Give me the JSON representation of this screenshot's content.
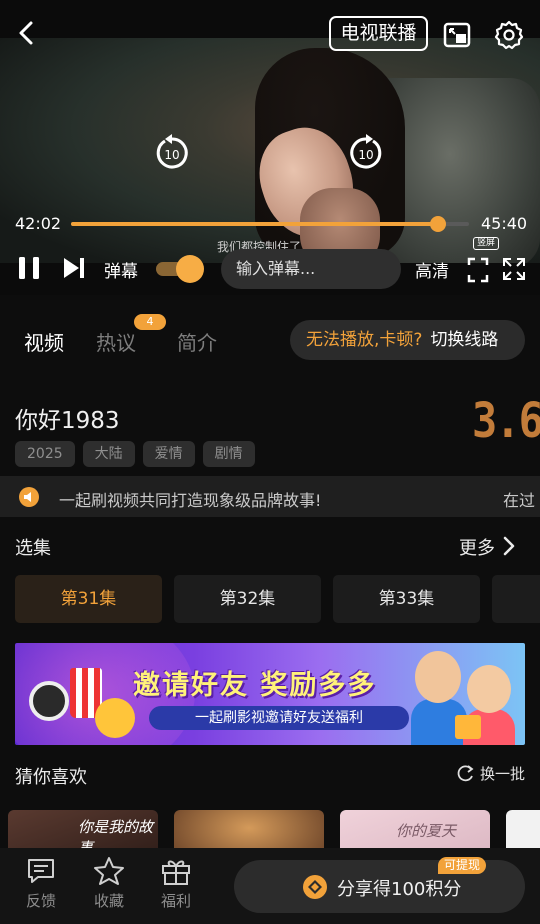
{
  "player": {
    "tv_button": "电视联播",
    "current_time": "42:02",
    "duration": "45:40",
    "progress_fraction": 0.921,
    "danmaku_label": "弹幕",
    "danmaku_hint": "我们都控制住了",
    "danmaku_placeholder": "输入弹幕...",
    "quality_label": "高清",
    "portrait_tag": "竖屏",
    "skip_seconds": "10"
  },
  "tabs": {
    "video": "视频",
    "hot": "热议",
    "hot_badge": "4",
    "intro": "简介",
    "switch_question": "无法播放,卡顿?",
    "switch_action": "切换线路"
  },
  "show": {
    "title": "你好1983",
    "score": "3.6",
    "tags": [
      "2025",
      "大陆",
      "爱情",
      "剧情"
    ]
  },
  "notice": {
    "text": "一起刷视频共同打造现象级品牌故事!",
    "next_text": "在过"
  },
  "episodes": {
    "title": "选集",
    "more": "更多",
    "items": [
      "第31集",
      "第32集",
      "第33集",
      ""
    ]
  },
  "banner": {
    "title": "邀请好友 奖励多多",
    "subtitle": "一起刷影视邀请好友送福利"
  },
  "recommend": {
    "title": "猜你喜欢",
    "refresh": "换一批",
    "items": [
      {
        "text": "你是我的故事",
        "color": "#3a2620"
      },
      {
        "text": "",
        "color": "#8a5a35"
      },
      {
        "text": "你的夏天",
        "color": "#e8c8d0"
      },
      {
        "text": "",
        "color": "#f2f2f2"
      }
    ]
  },
  "bottom_bar": {
    "feedback": "反馈",
    "favorite": "收藏",
    "welfare": "福利",
    "share": "分享得100积分",
    "withdraw_badge": "可提现"
  },
  "colors": {
    "accent": "#f2a23a",
    "background": "#0d0d0d",
    "score": "#c27c3a"
  }
}
